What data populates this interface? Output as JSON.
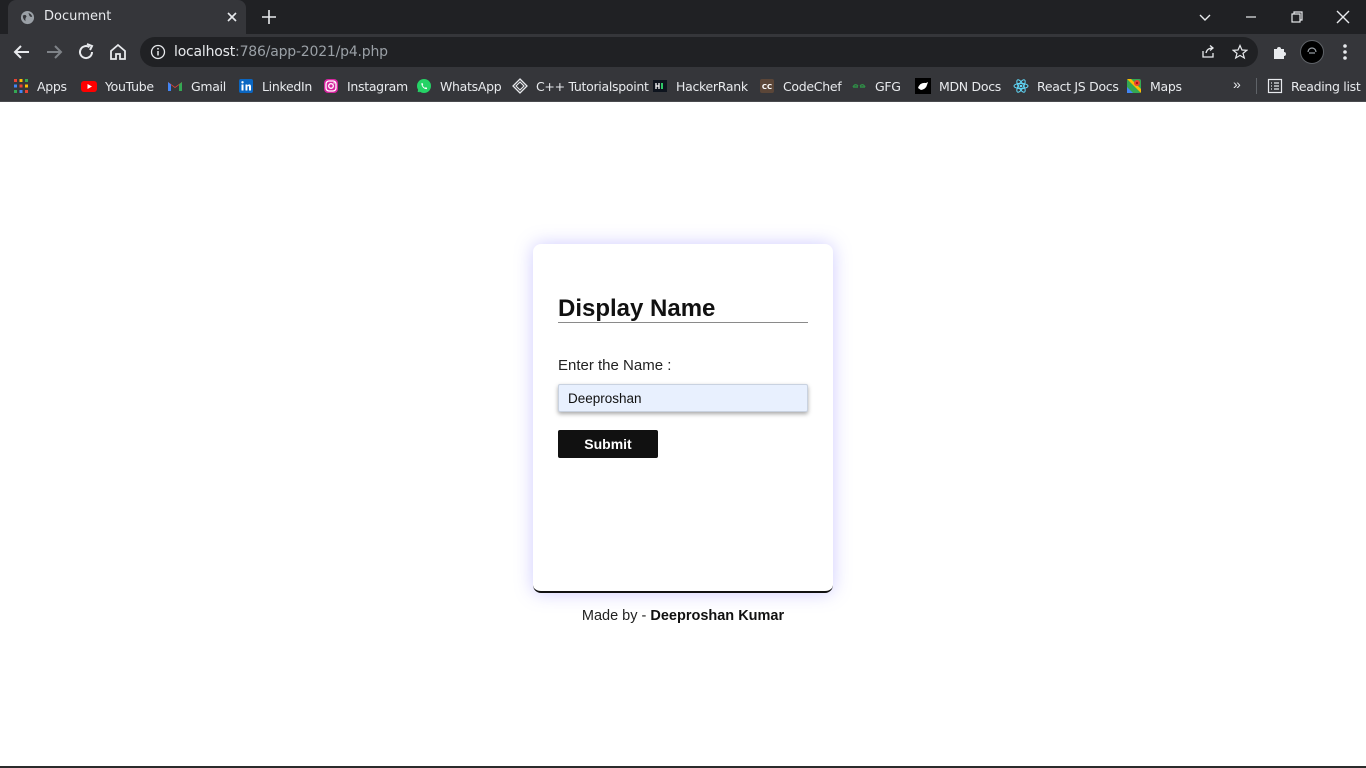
{
  "browser": {
    "tab": {
      "title": "Document",
      "favicon": "globe-icon"
    },
    "address": {
      "host": "localhost",
      "path": ":786/app-2021/p4.php"
    },
    "bookmarks": [
      {
        "label": "Apps",
        "icon": "apps-grid-icon"
      },
      {
        "label": "YouTube",
        "icon": "youtube-icon"
      },
      {
        "label": "Gmail",
        "icon": "gmail-icon"
      },
      {
        "label": "LinkedIn",
        "icon": "linkedin-icon"
      },
      {
        "label": "Instagram",
        "icon": "instagram-icon"
      },
      {
        "label": "WhatsApp",
        "icon": "whatsapp-icon"
      },
      {
        "label": "C++ Tutorialspoint",
        "icon": "tutorialspoint-icon"
      },
      {
        "label": "HackerRank",
        "icon": "hackerrank-icon"
      },
      {
        "label": "CodeChef",
        "icon": "codechef-icon"
      },
      {
        "label": "GFG",
        "icon": "gfg-icon"
      },
      {
        "label": "MDN Docs",
        "icon": "mdn-icon"
      },
      {
        "label": "React JS Docs",
        "icon": "react-icon"
      },
      {
        "label": "Maps",
        "icon": "maps-icon"
      }
    ],
    "more_bookmarks": "»",
    "reading_list": "Reading list",
    "colors": {
      "chrome_dark": "#202124",
      "chrome_toolbar": "#35363a"
    }
  },
  "form": {
    "title": "Display Name",
    "label": "Enter the Name :",
    "input_value": "Deeproshan",
    "submit_label": "Submit",
    "colors": {
      "input_bg": "#e8f0fe",
      "button_bg": "#111111",
      "card_glow": "#8278ff"
    }
  },
  "credit": {
    "prefix": "Made by - ",
    "author": "Deeproshan Kumar"
  }
}
